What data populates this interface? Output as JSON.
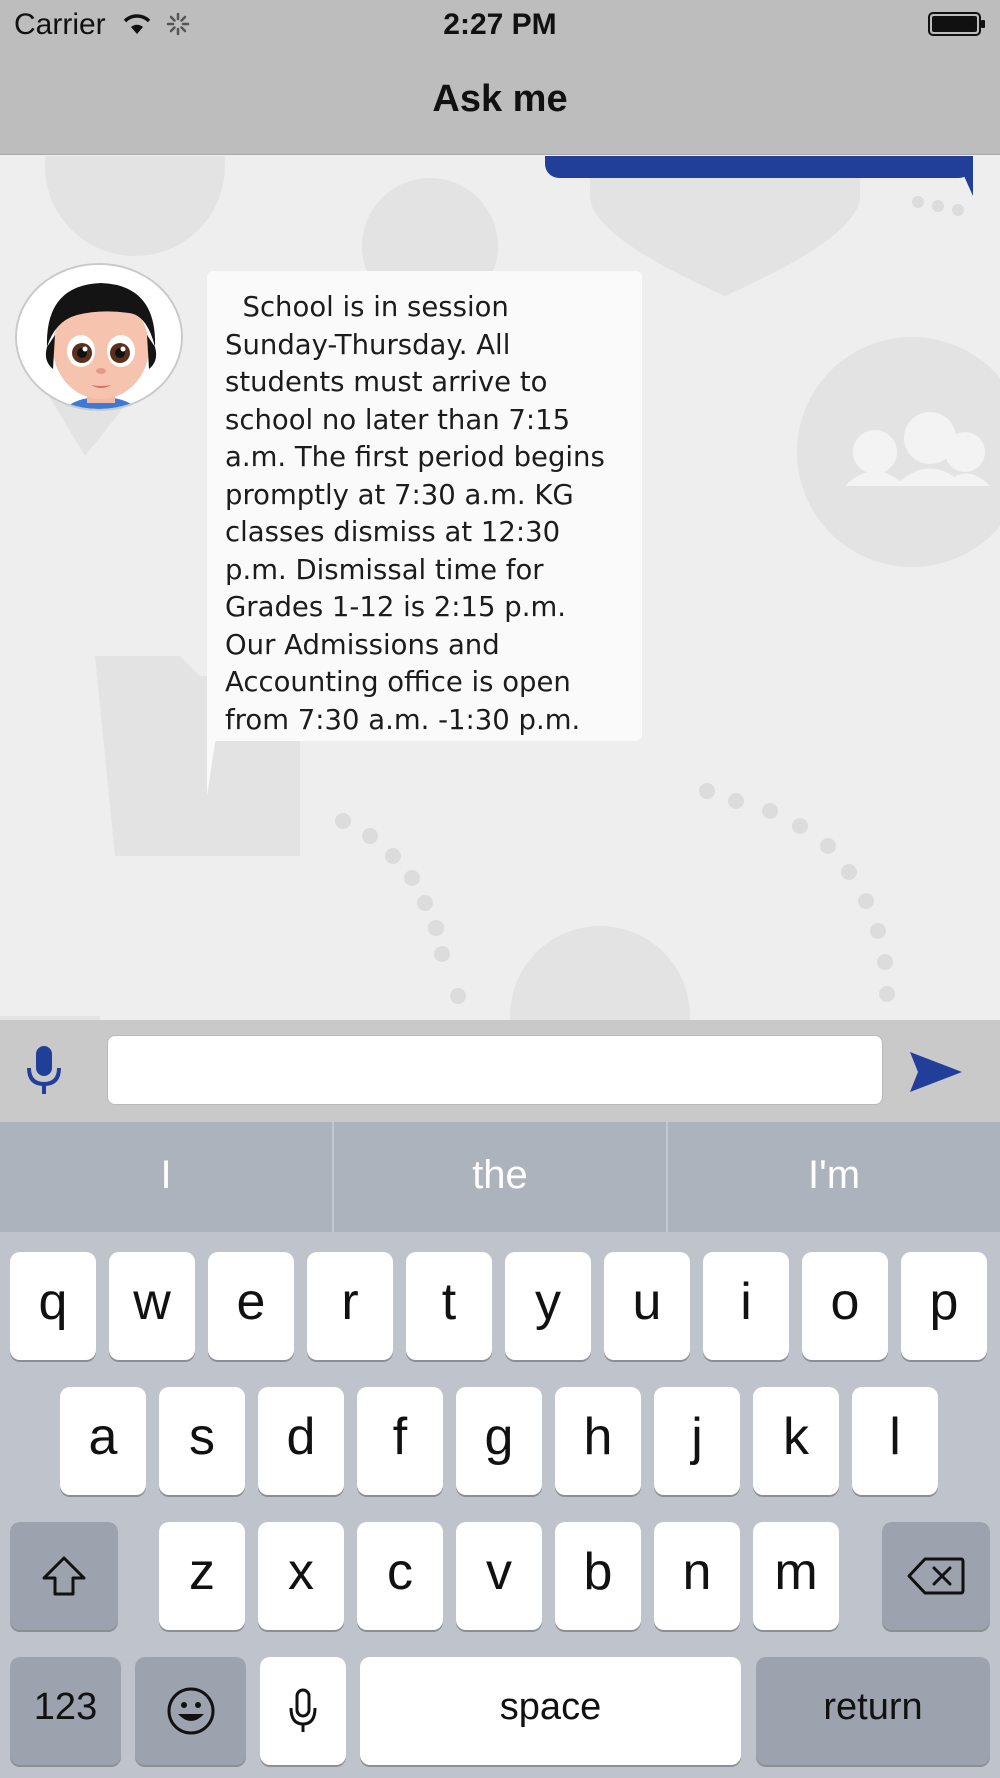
{
  "status_bar": {
    "carrier": "Carrier",
    "time": "2:27 PM",
    "icons": [
      "wifi-icon",
      "spinner-icon",
      "battery-icon"
    ]
  },
  "nav": {
    "title": "Ask me"
  },
  "chat": {
    "bot_message_lines": [
      "  School is in session",
      "Sunday-Thursday. All",
      "students must arrive to",
      "school no later than 7:15",
      "a.m. The first period begins",
      "promptly at 7:30 a.m. KG",
      "classes dismiss at 12:30",
      "p.m. Dismissal time for",
      "Grades 1-12 is 2:15 p.m.",
      "Our Admissions and",
      "Accounting office is open",
      "from 7:30 a.m. -1:30 p.m."
    ],
    "colors": {
      "user_bubble": "#213f99",
      "accent": "#213f99"
    }
  },
  "input": {
    "value": "",
    "placeholder": ""
  },
  "keyboard": {
    "suggestions": [
      "I",
      "the",
      "I'm"
    ],
    "row1": [
      "q",
      "w",
      "e",
      "r",
      "t",
      "y",
      "u",
      "i",
      "o",
      "p"
    ],
    "row2": [
      "a",
      "s",
      "d",
      "f",
      "g",
      "h",
      "j",
      "k",
      "l"
    ],
    "row3": [
      "z",
      "x",
      "c",
      "v",
      "b",
      "n",
      "m"
    ],
    "numbers_label": "123",
    "space_label": "space",
    "return_label": "return"
  }
}
